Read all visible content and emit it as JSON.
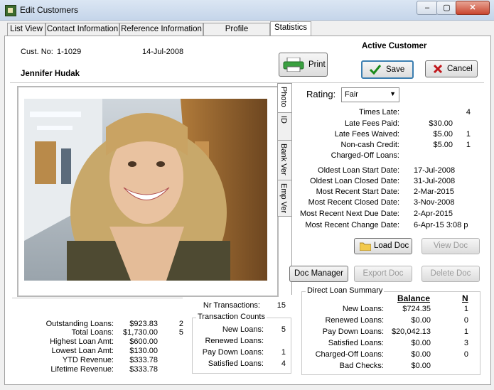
{
  "window": {
    "title": "Edit Customers",
    "min": "–",
    "max": "▢",
    "close": "✕"
  },
  "tabs": [
    "List View",
    "Contact Information",
    "Reference Information",
    "Profile Information",
    "Statistics"
  ],
  "header": {
    "cust_no_label": "Cust. No:",
    "cust_no": "1-1029",
    "date": "14-Jul-2008",
    "name": "Jennifer Hudak",
    "status": "Active Customer"
  },
  "buttons": {
    "print": "Print",
    "save": "Save",
    "cancel": "Cancel",
    "load_doc": "Load Doc",
    "view_doc": "View Doc",
    "doc_manager": "Doc Manager",
    "export_doc": "Export Doc",
    "delete_doc": "Delete Doc"
  },
  "side_tabs": [
    "Photo",
    "ID",
    "Bank Ver",
    "Emp Ver"
  ],
  "rating": {
    "label": "Rating:",
    "value": "Fair"
  },
  "stats": [
    {
      "label": "Times Late:",
      "value": "",
      "count": "4"
    },
    {
      "label": "Late Fees Paid:",
      "value": "$30.00",
      "count": ""
    },
    {
      "label": "Late Fees Waived:",
      "value": "$5.00",
      "count": "1"
    },
    {
      "label": "Non-cash Credit:",
      "value": "$5.00",
      "count": "1"
    },
    {
      "label": "Charged-Off Loans:",
      "value": "",
      "count": ""
    }
  ],
  "dates": [
    {
      "label": "Oldest Loan Start Date:",
      "value": "17-Jul-2008"
    },
    {
      "label": "Oldest Loan Closed Date:",
      "value": "31-Jul-2008"
    },
    {
      "label": "Most Recent Start Date:",
      "value": "2-Mar-2015"
    },
    {
      "label": "Most Recent Closed Date:",
      "value": "3-Nov-2008"
    },
    {
      "label": "Most Recent Next Due Date:",
      "value": "2-Apr-2015"
    },
    {
      "label": "Most Recent Change Date:",
      "value": "6-Apr-15 3:08 p"
    }
  ],
  "totals": [
    {
      "label": "Outstanding Loans:",
      "value": "$923.83",
      "count": "2"
    },
    {
      "label": "Total Loans:",
      "value": "$1,730.00",
      "count": "5"
    },
    {
      "label": "Highest Loan Amt:",
      "value": "$600.00",
      "count": ""
    },
    {
      "label": "Lowest Loan Amt:",
      "value": "$130.00",
      "count": ""
    },
    {
      "label": "YTD Revenue:",
      "value": "$333.78",
      "count": ""
    },
    {
      "label": "Lifetime Revenue:",
      "value": "$333.78",
      "count": ""
    }
  ],
  "transactions": {
    "nr_label": "Nr Transactions:",
    "nr": "15",
    "group_title": "Transaction Counts",
    "rows": [
      {
        "label": "New Loans:",
        "count": "5"
      },
      {
        "label": "Renewed Loans:",
        "count": ""
      },
      {
        "label": "Pay Down Loans:",
        "count": "1"
      },
      {
        "label": "Satisfied Loans:",
        "count": "4"
      }
    ]
  },
  "direct_loan": {
    "title": "Direct Loan Summary",
    "balance_header": "Balance",
    "n_header": "N",
    "rows": [
      {
        "label": "New Loans:",
        "balance": "$724.35",
        "n": "1"
      },
      {
        "label": "Renewed Loans:",
        "balance": "$0.00",
        "n": "0"
      },
      {
        "label": "Pay Down Loans:",
        "balance": "$20,042.13",
        "n": "1"
      },
      {
        "label": "Satisfied Loans:",
        "balance": "$0.00",
        "n": "3"
      },
      {
        "label": "Charged-Off Loans:",
        "balance": "$0.00",
        "n": "0"
      },
      {
        "label": "Bad Checks:",
        "balance": "$0.00",
        "n": ""
      }
    ]
  },
  "colors": {
    "save_check": "#1a8a1a",
    "cancel_x": "#c0161b"
  }
}
